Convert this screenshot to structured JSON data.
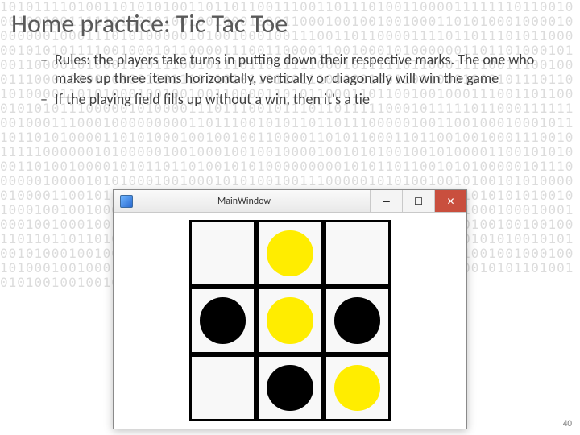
{
  "background_bits": "10101111010011010101001101101100111001101110100110000111111101100100010010011111010010100100100010001100010010010010001101010001000010000000100011101010000010100100010011100110110000111101101110101100000101010111100100010110000111001100001100100010100000011011010001010011000010100011101110010111011011111000101111101100011110011100100011100010000000001101110010101101101110000010011001000100010111011010100001101010001001001001100001101011000110110010010001110011011000101010111000001010000111011100101110110111110001011111011000111111001000111000100000000011011100101011011011100000100110010001000101110110101000011010100010010010011000011010110001101100100100011100101111100000010100000100100010010010000100101010010010100001100101010001101001000010101101101001010100000000010101101100101010000010111000000100001010100010010001010100100111000001010100100101001010100000100001100101101010101110110101010101001011010101010101010101010010100010010010001000100010000000000000100010001001001000100010001000100010010001001000100100010001001001000100010010010010001001001001001101101101101010101010101101010101101001010100100010100101010010101001010001001001000100101010010100100100010010010010010100100100010010100010010001001001001001010001000100010010010001001000101011010010101001001001001010100101001010100100101001010",
  "title": "Home practice: Tic Tac Toe",
  "bullets": [
    "Rules: the players take turns in putting down their respective marks. The one who makes up three items horizontally, vertically or diagonally will win the game",
    "If the playing field fills up without a win, then it's a tie"
  ],
  "page_num": "40",
  "window": {
    "title": "MainWindow",
    "min_icon": "min-icon",
    "max_icon": "max-icon",
    "close_icon": "close-icon"
  },
  "board": [
    [
      "empty",
      "yellow",
      "empty"
    ],
    [
      "black",
      "yellow",
      "black"
    ],
    [
      "empty",
      "black",
      "yellow"
    ]
  ]
}
